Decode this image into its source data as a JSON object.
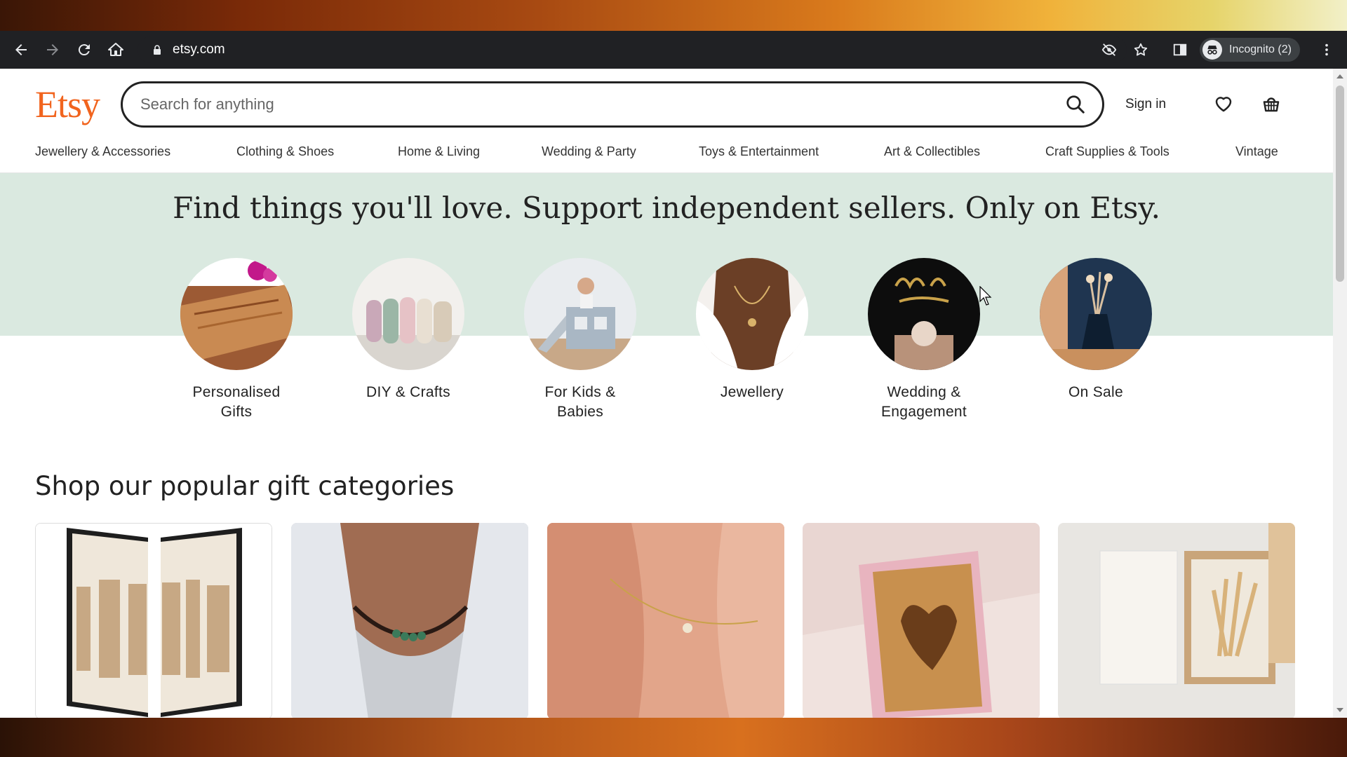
{
  "browser": {
    "url": "etsy.com",
    "incognito_label": "Incognito (2)"
  },
  "header": {
    "logo": "Etsy",
    "search_placeholder": "Search for anything",
    "sign_in": "Sign in"
  },
  "categories": [
    "Jewellery & Accessories",
    "Clothing & Shoes",
    "Home & Living",
    "Wedding & Party",
    "Toys & Entertainment",
    "Art & Collectibles",
    "Craft Supplies & Tools",
    "Vintage"
  ],
  "hero": {
    "title": "Find things you'll love. Support independent sellers. Only on Etsy.",
    "circles": [
      {
        "label_1": "Personalised",
        "label_2": "Gifts"
      },
      {
        "label_1": "DIY & Crafts",
        "label_2": ""
      },
      {
        "label_1": "For Kids &",
        "label_2": "Babies"
      },
      {
        "label_1": "Jewellery",
        "label_2": ""
      },
      {
        "label_1": "Wedding &",
        "label_2": "Engagement"
      },
      {
        "label_1": "On Sale",
        "label_2": ""
      }
    ]
  },
  "popular": {
    "title": "Shop our popular gift categories"
  },
  "colors": {
    "brand": "#f1641e",
    "hero_bg": "#dae9e0"
  }
}
